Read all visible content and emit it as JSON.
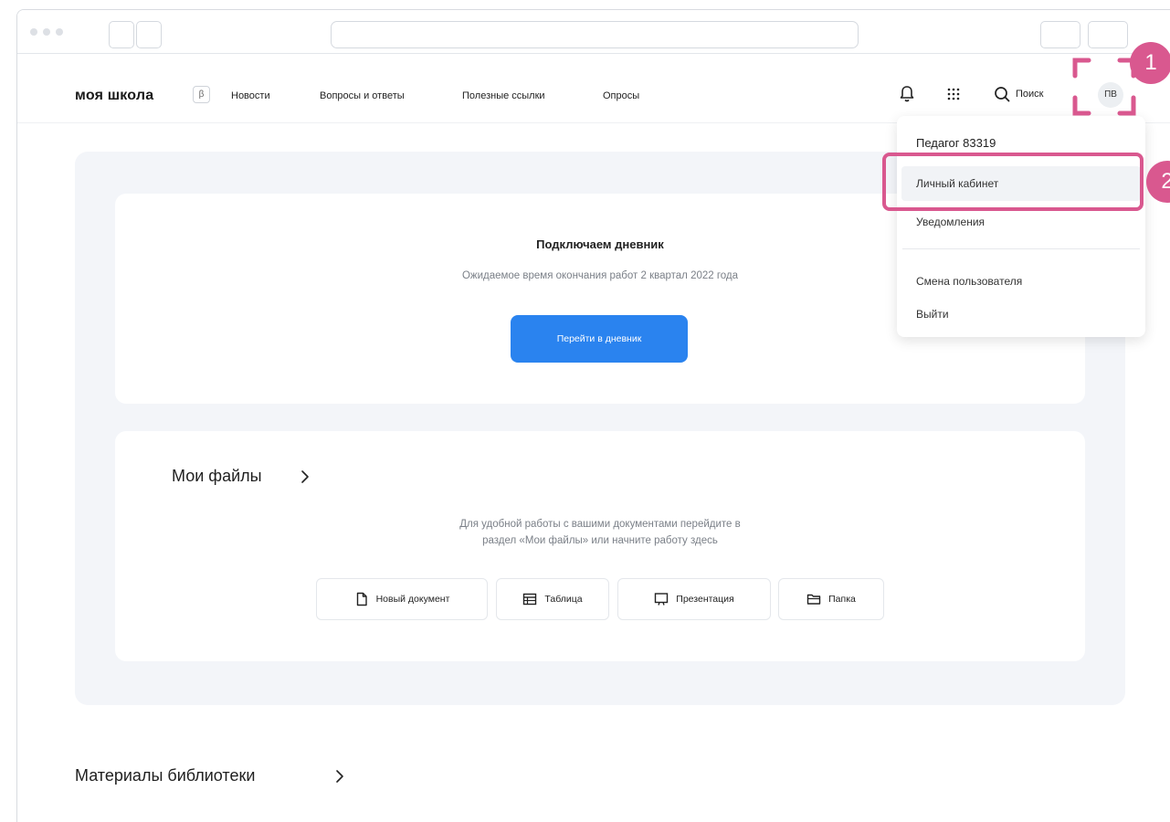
{
  "header": {
    "logo": "моя школа",
    "beta": "β",
    "nav": [
      "Новости",
      "Вопросы и ответы",
      "Полезные ссылки",
      "Опросы"
    ],
    "search_label": "Поиск",
    "avatar_initials": "ПВ"
  },
  "annotations": {
    "step1": "1",
    "step2": "2",
    "accent_color": "#d9588f"
  },
  "diary_card": {
    "title": "Подключаем дневник",
    "subtitle": "Ожидаемое время окончания работ 2 квартал 2022 года",
    "button": "Перейти в дневник"
  },
  "files_card": {
    "title": "Мои файлы",
    "desc_line1": "Для удобной работы с вашими документами перейдите в",
    "desc_line2": "раздел «Мои файлы» или начните работу здесь",
    "buttons": [
      {
        "label": "Новый документ",
        "icon": "document-icon"
      },
      {
        "label": "Таблица",
        "icon": "table-icon"
      },
      {
        "label": "Презентация",
        "icon": "presentation-icon"
      },
      {
        "label": "Папка",
        "icon": "folder-icon"
      }
    ]
  },
  "library": {
    "title": "Материалы библиотеки"
  },
  "user_menu": {
    "user_name": "Педагог 83319",
    "items": [
      "Личный кабинет",
      "Уведомления",
      "Смена пользователя",
      "Выйти"
    ]
  },
  "colors": {
    "primary": "#2a83ef",
    "panel_bg": "#f3f5f9"
  }
}
